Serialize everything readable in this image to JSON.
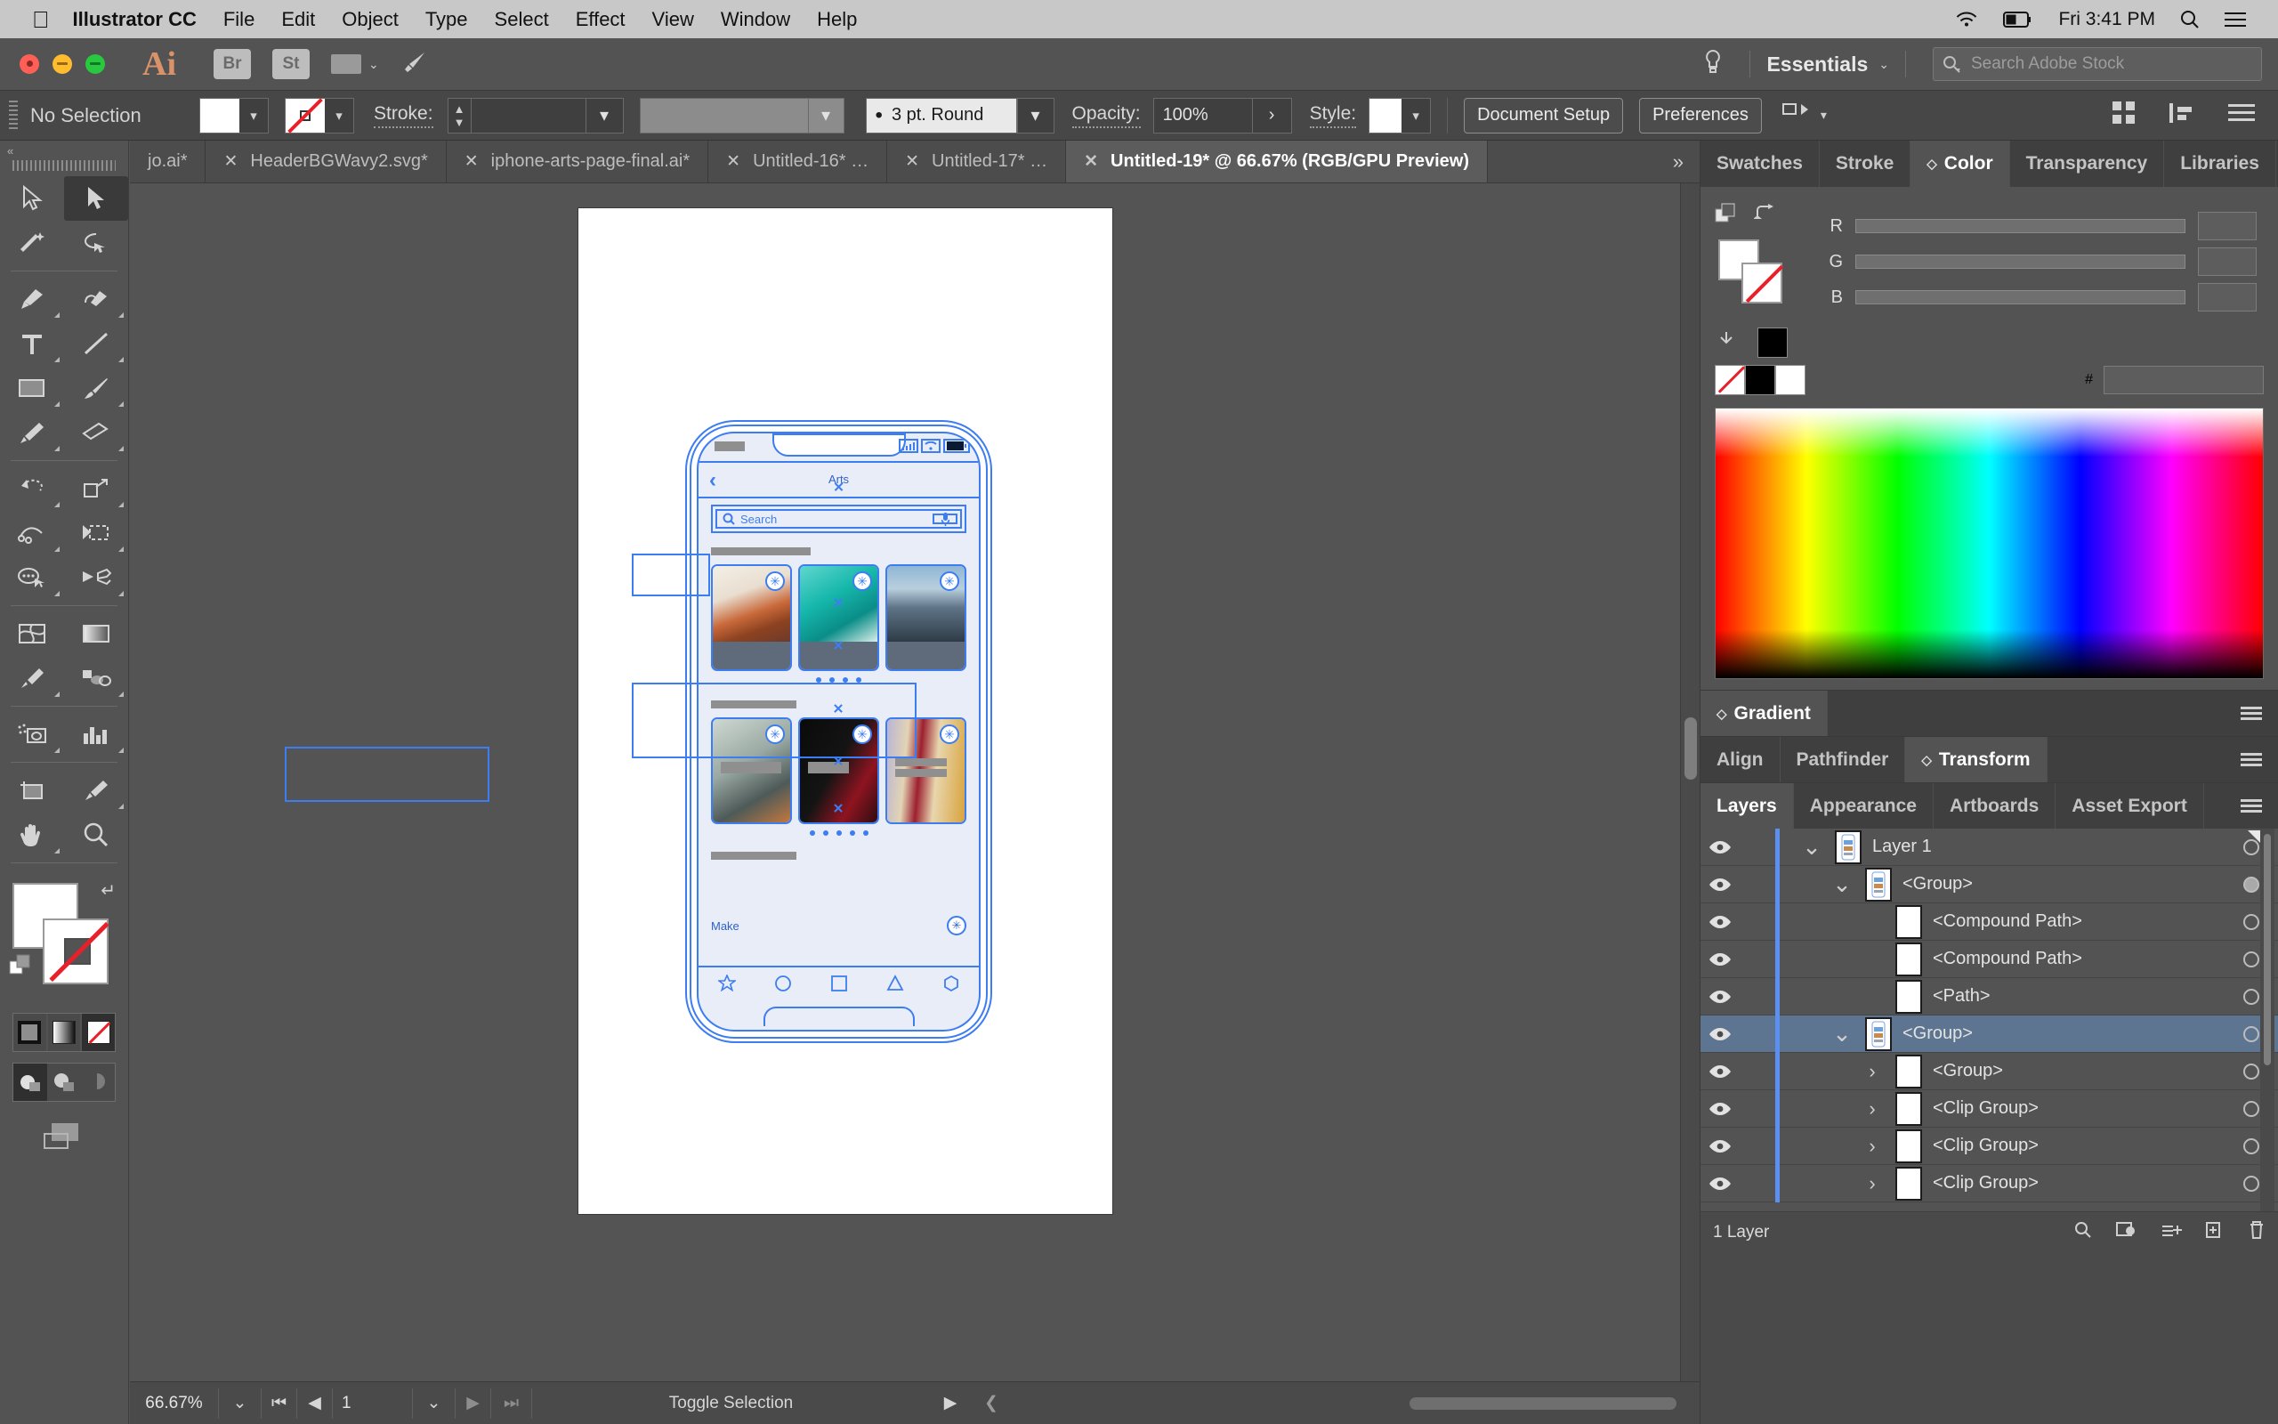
{
  "os_menubar": {
    "apple_icon": "apple-icon",
    "app_name": "Illustrator CC",
    "menus": [
      "File",
      "Edit",
      "Object",
      "Type",
      "Select",
      "Effect",
      "View",
      "Window",
      "Help"
    ],
    "wifi_icon": "wifi-icon",
    "battery_icon": "battery-icon",
    "clock": "Fri 3:41 PM",
    "spotlight_icon": "search-icon",
    "control_center_icon": "control-center-icon"
  },
  "app_bar": {
    "traffic_lights": [
      "close-button",
      "minimize-button",
      "zoom-button"
    ],
    "logo": "Ai",
    "bridge_label": "Br",
    "stock_label": "St",
    "arrange_icon": "arrange-documents-icon",
    "arrange_chevron": "⌄",
    "brush_icon": "brush-icon",
    "bulb_icon": "search-help-icon",
    "workspace": "Essentials",
    "workspace_chevron": "⌄",
    "stock_search_placeholder": "Search Adobe Stock",
    "stock_search_icon": "search-icon"
  },
  "control_bar": {
    "selection_status": "No Selection",
    "fill_swatch": "#FFFFFF",
    "stroke_swatch": "none",
    "stroke_label": "Stroke:",
    "stroke_weight": "",
    "stroke_profile": "",
    "brush_definition": "3 pt. Round",
    "opacity_label": "Opacity:",
    "opacity_value": "100%",
    "style_label": "Style:",
    "style_swatch": "#FFFFFF",
    "document_setup": "Document Setup",
    "preferences": "Preferences",
    "align_icon": "align-icon",
    "grid_icon": "grid-view-icon",
    "distribute_icon": "distribute-icon",
    "list_icon": "list-view-icon"
  },
  "tabs": {
    "items": [
      {
        "label": "jo.ai*",
        "active": false
      },
      {
        "label": "HeaderBGWavy2.svg*",
        "active": false
      },
      {
        "label": "iphone-arts-page-final.ai*",
        "active": false
      },
      {
        "label": "Untitled-16* …",
        "active": false
      },
      {
        "label": "Untitled-17* …",
        "active": false
      },
      {
        "label": "Untitled-19* @ 66.67% (RGB/GPU Preview)",
        "active": true
      }
    ],
    "overflow": "»",
    "close_icon": "close-icon"
  },
  "toolbar": {
    "tools": [
      "selection-tool",
      "direct-selection-tool",
      "magic-wand-tool",
      "lasso-tool",
      "pen-tool",
      "curvature-tool",
      "type-tool",
      "line-segment-tool",
      "rectangle-tool",
      "paintbrush-tool",
      "pencil-tool",
      "eraser-tool",
      "rotate-tool",
      "scale-tool",
      "width-tool",
      "free-transform-tool",
      "shape-builder-tool",
      "perspective-grid-tool",
      "mesh-tool",
      "gradient-tool",
      "eyedropper-tool",
      "blend-tool",
      "symbol-sprayer-tool",
      "column-graph-tool",
      "artboard-tool",
      "slice-tool",
      "hand-tool",
      "zoom-tool"
    ],
    "selected_tool": "direct-selection-tool",
    "fill_color": "#FFFFFF",
    "stroke_color": "none",
    "swap_icon": "swap-fill-stroke-icon",
    "default_icon": "default-fill-stroke-icon",
    "paint_modes": [
      "color-mode",
      "gradient-mode",
      "none-mode"
    ],
    "paint_mode_selected": "none-mode",
    "draw_modes": [
      "draw-normal",
      "draw-behind",
      "draw-inside"
    ],
    "draw_mode_selected": "draw-normal",
    "screen_mode_icon": "change-screen-mode-icon"
  },
  "canvas": {
    "artboard": {
      "phone_mockup": {
        "status_bar": {
          "carrier_placeholder": "",
          "signal_icon": "signal-icon",
          "wifi_icon": "wifi-icon",
          "battery_icon": "battery-icon"
        },
        "nav": {
          "back_icon": "back-chevron-icon",
          "title": "Arts"
        },
        "search": {
          "placeholder": "Search",
          "search_icon": "search-icon",
          "mic_icon": "microphone-icon"
        },
        "section1": {
          "heading_placeholder": "",
          "cards": [
            {
              "image": "beach-rocks-photo",
              "badge": "asterisk-icon"
            },
            {
              "image": "surfer-wave-photo",
              "badge": "asterisk-icon"
            },
            {
              "image": "person-cliff-photo",
              "badge": "asterisk-icon"
            }
          ],
          "pager_dots": 4
        },
        "section2": {
          "heading_placeholder": "",
          "cards": [
            {
              "image": "vintage-camera-photo",
              "badge": "asterisk-icon"
            },
            {
              "image": "cinema-seats-photo",
              "badge": "asterisk-icon"
            },
            {
              "image": "books-shelf-photo",
              "badge": "asterisk-icon"
            }
          ],
          "pager_dots": 5
        },
        "section3": {
          "heading_placeholder": "",
          "row_label": "Make",
          "row_badge": "asterisk-icon"
        },
        "tab_bar": [
          "star-icon",
          "circle-icon",
          "square-icon",
          "triangle-icon",
          "hexagon-icon"
        ],
        "home_indicator": "home-indicator"
      }
    }
  },
  "status_bar": {
    "zoom_level": "66.67%",
    "zoom_chevron": "⌄",
    "first_icon": "first-artboard-icon",
    "prev_icon": "previous-artboard-icon",
    "artboard_number": "1",
    "artboard_chevron": "⌄",
    "next_icon": "next-artboard-icon",
    "last_icon": "last-artboard-icon",
    "status_text": "Toggle Selection",
    "play_icon": "play-icon",
    "back_icon": "back-icon"
  },
  "right_dock": {
    "color_group": {
      "tabs": [
        {
          "label": "Swatches",
          "active": false,
          "pin": false
        },
        {
          "label": "Stroke",
          "active": false,
          "pin": false
        },
        {
          "label": "Color",
          "active": true,
          "pin": true
        },
        {
          "label": "Transparency",
          "active": false,
          "pin": false
        },
        {
          "label": "Libraries",
          "active": false,
          "pin": false
        }
      ],
      "menu_icon": "panel-menu-icon",
      "channels": [
        {
          "name": "R",
          "value": ""
        },
        {
          "name": "G",
          "value": ""
        },
        {
          "name": "B",
          "value": ""
        }
      ],
      "hex_label": "#",
      "hex_value": "",
      "fill_swatch": "#FFFFFF",
      "stroke_swatch": "none",
      "none_swatch": "none",
      "black_swatch": "#000000",
      "white_swatch": "#FFFFFF"
    },
    "gradient_group": {
      "tabs": [
        {
          "label": "Gradient",
          "active": true,
          "pin": true
        }
      ],
      "menu_icon": "panel-menu-icon"
    },
    "transform_group": {
      "tabs": [
        {
          "label": "Align",
          "active": false,
          "pin": false
        },
        {
          "label": "Pathfinder",
          "active": false,
          "pin": false
        },
        {
          "label": "Transform",
          "active": true,
          "pin": true
        }
      ],
      "menu_icon": "panel-menu-icon"
    },
    "layers_group": {
      "tabs": [
        {
          "label": "Layers",
          "active": true,
          "pin": false
        },
        {
          "label": "Appearance",
          "active": false,
          "pin": false
        },
        {
          "label": "Artboards",
          "active": false,
          "pin": false
        },
        {
          "label": "Asset Export",
          "active": false,
          "pin": false
        }
      ],
      "menu_icon": "panel-menu-icon",
      "rows": [
        {
          "name": "Layer 1",
          "indent": 0,
          "expander": "down",
          "thumb": "artwork-thumb",
          "selected": false,
          "target_filled": false
        },
        {
          "name": "<Group>",
          "indent": 1,
          "expander": "down",
          "thumb": "artwork-thumb",
          "selected": false,
          "target_filled": true
        },
        {
          "name": "<Compound Path>",
          "indent": 2,
          "expander": "none",
          "thumb": "blank-thumb",
          "selected": false,
          "target_filled": false
        },
        {
          "name": "<Compound Path>",
          "indent": 2,
          "expander": "none",
          "thumb": "blank-thumb",
          "selected": false,
          "target_filled": false
        },
        {
          "name": "<Path>",
          "indent": 2,
          "expander": "none",
          "thumb": "blank-thumb",
          "selected": false,
          "target_filled": false
        },
        {
          "name": "<Group>",
          "indent": 1,
          "expander": "down",
          "thumb": "artwork-thumb",
          "selected": true,
          "target_filled": false
        },
        {
          "name": "<Group>",
          "indent": 2,
          "expander": "right",
          "thumb": "blank-thumb",
          "selected": false,
          "target_filled": false
        },
        {
          "name": "<Clip Group>",
          "indent": 2,
          "expander": "right",
          "thumb": "blank-thumb",
          "selected": false,
          "target_filled": false
        },
        {
          "name": "<Clip Group>",
          "indent": 2,
          "expander": "right",
          "thumb": "blank-thumb",
          "selected": false,
          "target_filled": false
        },
        {
          "name": "<Clip Group>",
          "indent": 2,
          "expander": "right",
          "thumb": "blank-thumb",
          "selected": false,
          "target_filled": false
        }
      ],
      "footer_text": "1 Layer",
      "footer_icons": [
        "locate-object-icon",
        "make-mask-icon",
        "new-sublayer-icon",
        "new-layer-icon",
        "delete-selection-icon"
      ]
    }
  },
  "colors": {
    "accent_blue": "#3D7DF2",
    "selection_row": "#5D7591",
    "panel_bg": "#535353",
    "chrome_bg": "#4A4A4A",
    "menubar_bg": "#C8C8C8"
  }
}
